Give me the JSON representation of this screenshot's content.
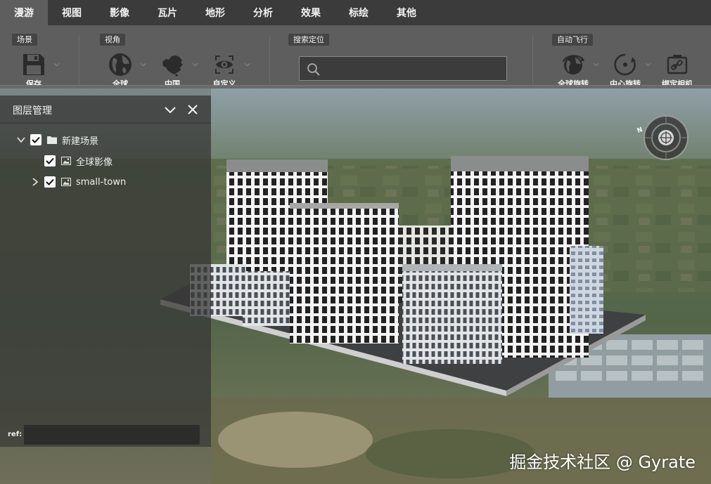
{
  "menu": {
    "tabs": [
      {
        "label": "漫游",
        "active": true
      },
      {
        "label": "视图",
        "active": false
      },
      {
        "label": "影像",
        "active": false
      },
      {
        "label": "瓦片",
        "active": false
      },
      {
        "label": "地形",
        "active": false
      },
      {
        "label": "分析",
        "active": false
      },
      {
        "label": "效果",
        "active": false
      },
      {
        "label": "标绘",
        "active": false
      },
      {
        "label": "其他",
        "active": false
      }
    ]
  },
  "ribbon": {
    "groups": {
      "scene": "场景",
      "view": "视角",
      "search": "搜索定位",
      "autofly": "自动飞行"
    },
    "tools": {
      "save": {
        "label": "保存",
        "icon": "save-icon"
      },
      "globe": {
        "label": "全球",
        "icon": "globe-icon"
      },
      "china": {
        "label": "中国",
        "icon": "china-map-icon"
      },
      "custom": {
        "label": "自定义",
        "icon": "eye-icon"
      },
      "global_rotate": {
        "label": "全球旋转",
        "icon": "globe-rotate-icon"
      },
      "center_rotate": {
        "label": "中心旋转",
        "icon": "center-rotate-icon"
      },
      "bind_camera": {
        "label": "绑定相机",
        "icon": "bind-camera-icon"
      }
    },
    "search": {
      "value": "",
      "placeholder": ""
    }
  },
  "layer_panel": {
    "title": "图层管理",
    "tree": [
      {
        "label": "新建场景",
        "checked": true,
        "icon": "folder-icon",
        "expanded": true
      },
      {
        "label": "全球影像",
        "checked": true,
        "icon": "image-icon"
      },
      {
        "label": "small-town",
        "checked": true,
        "icon": "image-icon",
        "expanded": false
      }
    ],
    "ref_label": "ref:",
    "ref_value": ""
  },
  "compass": {
    "north_label": "N"
  },
  "watermark": "掘金技术社区 @ Gyrate",
  "colors": {
    "menubar_bg": "#3b3b3b",
    "ribbon_bg": "#5e5e5e",
    "active_tab": "#5e5e5e",
    "panel_bg": "#303030",
    "text": "#f2f2f2"
  }
}
